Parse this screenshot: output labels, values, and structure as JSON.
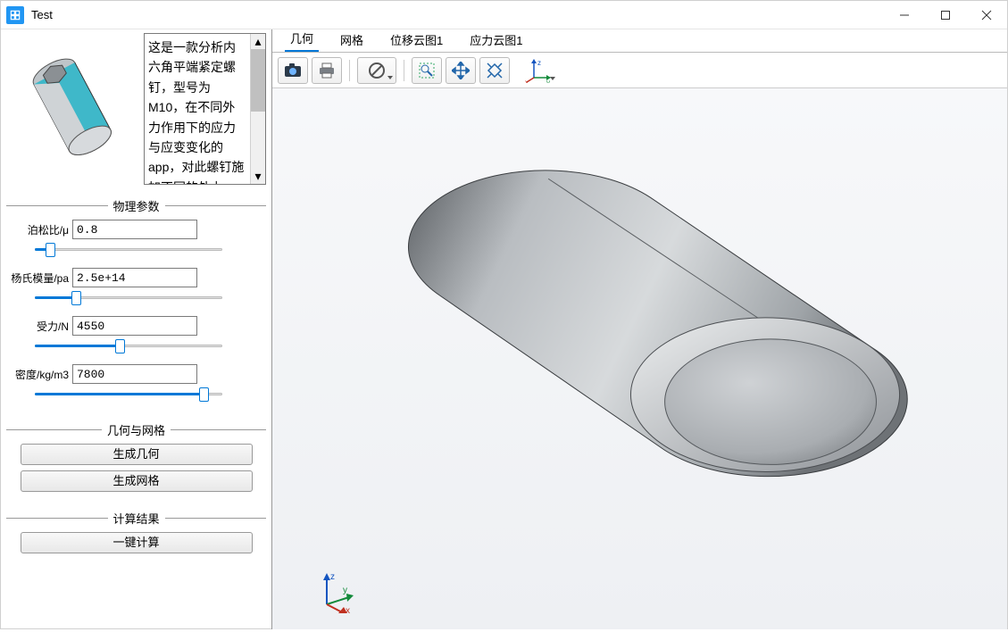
{
  "window": {
    "title": "Test"
  },
  "description": "这是一款分析内六角平端紧定螺钉，型号为M10，在不同外力作用下的应力与应变变化的app，对此螺钉施加不同的外力",
  "sections": {
    "physics": "物理参数",
    "geom": "几何与网格",
    "result": "计算结果"
  },
  "params": {
    "poisson": {
      "label": "泊松比/μ",
      "value": "0.8",
      "pct": 8
    },
    "young": {
      "label": "杨氏模量/pa",
      "value": "2.5e+14",
      "pct": 22
    },
    "force": {
      "label": "受力/N",
      "value": "4550",
      "pct": 45
    },
    "density": {
      "label": "密度/kg/m3",
      "value": "7800",
      "pct": 90
    }
  },
  "buttons": {
    "gen_geom": "生成几何",
    "gen_mesh": "生成网格",
    "compute": "一键计算"
  },
  "tabs": {
    "geometry": "几何",
    "mesh": "网格",
    "disp": "位移云图1",
    "stress": "应力云图1"
  },
  "toolbar_icons": {
    "snapshot": "snapshot",
    "print": "print",
    "layers": "layers",
    "zoom_box": "zoom-box",
    "pan": "pan",
    "fit": "fit",
    "axes": "xyz-axes"
  },
  "axis_labels": {
    "x": "x",
    "y": "y",
    "z": "z"
  }
}
